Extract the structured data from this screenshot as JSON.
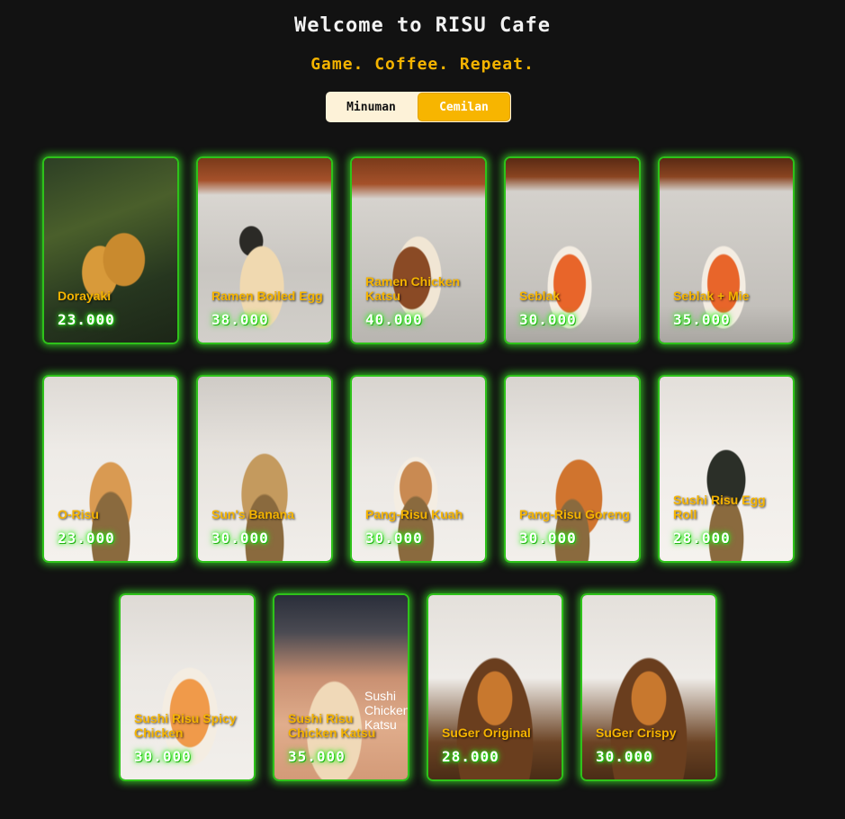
{
  "header": {
    "title": "Welcome to RISU Cafe",
    "subtitle": "Game. Coffee. Repeat."
  },
  "tabs": [
    {
      "label": "Minuman",
      "active": false
    },
    {
      "label": "Cemilan",
      "active": true
    }
  ],
  "colors": {
    "accent": "#f5b400",
    "glow": "#2ec21a",
    "background": "#121212"
  },
  "menu": [
    {
      "name": "Dorayaki",
      "price": "23.000"
    },
    {
      "name": "Ramen Boiled Egg",
      "price": "38.000"
    },
    {
      "name": "Ramen Chicken Katsu",
      "price": "40.000"
    },
    {
      "name": "Seblak",
      "price": "30.000"
    },
    {
      "name": "Seblak + Mie",
      "price": "35.000"
    },
    {
      "name": "O-Risu",
      "price": "23.000"
    },
    {
      "name": "Sun's Banana",
      "price": "30.000"
    },
    {
      "name": "Pang-Risu Kuah",
      "price": "30.000"
    },
    {
      "name": "Pang-Risu Goreng",
      "price": "30.000"
    },
    {
      "name": "Sushi Risu Egg Roll",
      "price": "28.000"
    },
    {
      "name": "Sushi Risu Spicy Chicken",
      "price": "30.000"
    },
    {
      "name": "Sushi Risu Chicken Katsu",
      "price": "35.000",
      "overlay": "Sushi Chicken Katsu"
    },
    {
      "name": "SuGer Original",
      "price": "28.000"
    },
    {
      "name": "SuGer Crispy",
      "price": "30.000"
    }
  ]
}
